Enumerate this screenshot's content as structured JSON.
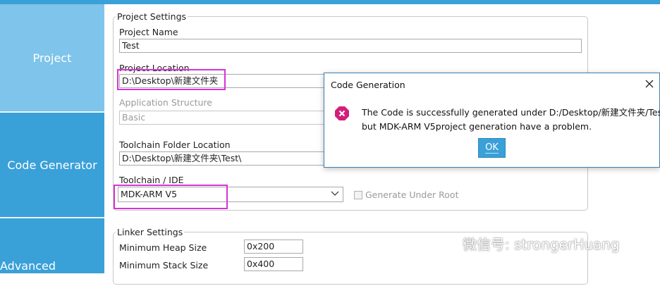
{
  "sidebar": {
    "items": [
      {
        "label": "Project"
      },
      {
        "label": "Code Generator"
      },
      {
        "label": "Advanced Settings"
      }
    ]
  },
  "project_settings": {
    "legend": "Project Settings",
    "project_name_label": "Project Name",
    "project_name_value": "Test",
    "project_location_label": "Project Location",
    "project_location_value": "D:\\Desktop\\新建文件夹",
    "app_structure_label": "Application Structure",
    "app_structure_value": "Basic",
    "toolchain_folder_label": "Toolchain Folder Location",
    "toolchain_folder_value": "D:\\Desktop\\新建文件夹\\Test\\",
    "toolchain_ide_label": "Toolchain / IDE",
    "toolchain_ide_value": "MDK-ARM V5",
    "generate_under_root_label": "Generate Under Root"
  },
  "linker_settings": {
    "legend": "Linker Settings",
    "min_heap_label": "Minimum Heap Size",
    "min_heap_value": "0x200",
    "min_stack_label": "Minimum Stack Size",
    "min_stack_value": "0x400"
  },
  "dialog": {
    "title": "Code Generation",
    "message_line1": "The Code is successfully generated under D:/Desktop/新建文件夹/Test",
    "message_line2": "but MDK-ARM V5project generation have a problem.",
    "ok_label": "OK"
  },
  "watermark": {
    "text": "微信号: strongerHuang"
  },
  "colors": {
    "accent": "#3aa0d8",
    "sidebar_active": "#7fc4ea",
    "highlight": "#d634d6",
    "error": "#d21f7a"
  }
}
